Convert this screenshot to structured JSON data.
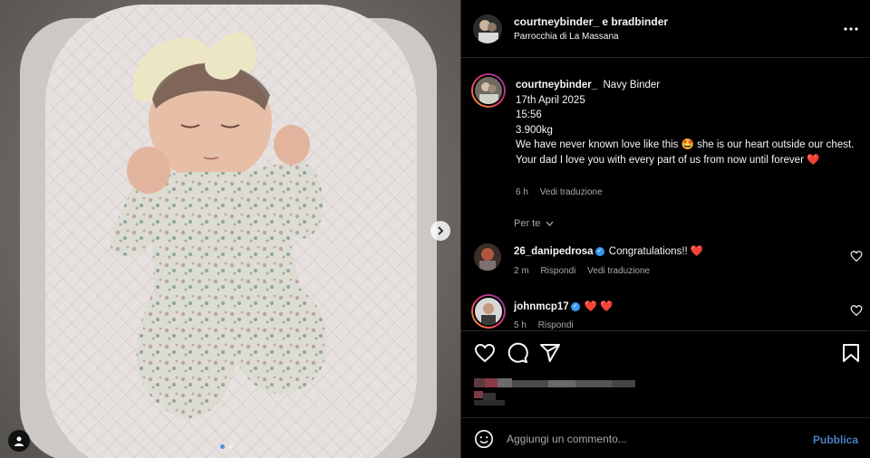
{
  "post": {
    "header": {
      "usernames": "courtneybinder_ e bradbinder",
      "location": "Parrocchia di La Massana"
    },
    "caption": {
      "username": "courtneybinder_",
      "text_l1": "Navy Binder",
      "text_l2": "17th April 2025",
      "text_l3": "15:56",
      "text_l4": "3.900kg",
      "text_l5": "We have never known love like this 🤩 she is our heart outside our chest. Your dad I love you with every part of us from now until forever ❤️",
      "time": "6 h",
      "translate": "Vedi traduzione"
    },
    "for_you": "Per te",
    "comments": [
      {
        "username": "26_danipedrosa",
        "verified": true,
        "text": "Congratulations!! ❤️",
        "time": "2 m",
        "reply": "Rispondi",
        "translate": "Vedi traduzione"
      },
      {
        "username": "johnmcp17",
        "verified": true,
        "text": "❤️ ❤️",
        "time": "5 h",
        "reply": "Rispondi"
      }
    ],
    "composer": {
      "placeholder": "Aggiungi un commento...",
      "publish": "Pubblica"
    },
    "carousel": {
      "slides": 2,
      "active": 1
    }
  },
  "colors": {
    "background": "#000000",
    "text": "#f5f5f5",
    "muted": "#a8a8a8",
    "heart": "#ff3040",
    "verified": "#3897f0",
    "publish": "#4a7fc1"
  },
  "icons": [
    "more-icon",
    "chevron-right-icon",
    "user-tag-icon",
    "heart-icon",
    "comment-icon",
    "share-icon",
    "bookmark-icon",
    "emoji-icon",
    "verified-icon",
    "chevron-down-icon"
  ]
}
